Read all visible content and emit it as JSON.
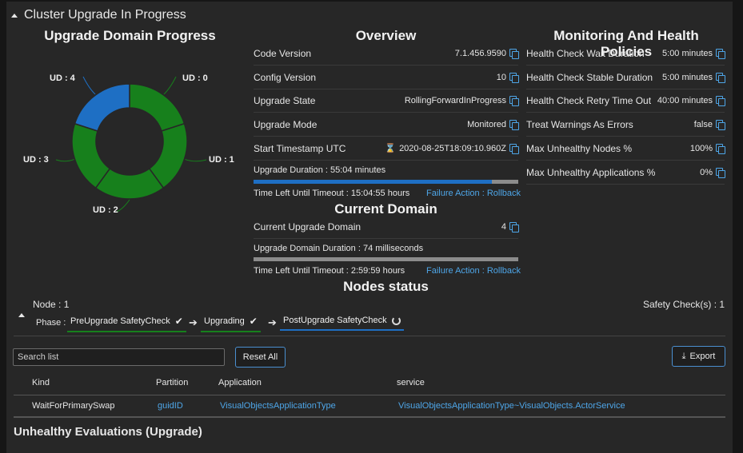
{
  "section": {
    "title": "Cluster Upgrade In Progress"
  },
  "upgrade_domain_progress": {
    "title": "Upgrade Domain Progress",
    "domains": [
      {
        "label": "UD : 0",
        "status": "completed",
        "color": "#17801c"
      },
      {
        "label": "UD : 1",
        "status": "completed",
        "color": "#17801c"
      },
      {
        "label": "UD : 2",
        "status": "completed",
        "color": "#17801c"
      },
      {
        "label": "UD : 3",
        "status": "completed",
        "color": "#17801c"
      },
      {
        "label": "UD : 4",
        "status": "in-progress",
        "color": "#1e6fc4"
      }
    ]
  },
  "overview": {
    "title": "Overview",
    "rows": [
      {
        "key": "Code Version",
        "value": "7.1.456.9590"
      },
      {
        "key": "Config Version",
        "value": "10"
      },
      {
        "key": "Upgrade State",
        "value": "RollingForwardInProgress"
      },
      {
        "key": "Upgrade Mode",
        "value": "Monitored"
      },
      {
        "key": "Start Timestamp UTC",
        "value": "2020-08-25T18:09:10.960Z"
      }
    ],
    "upgrade_duration": "Upgrade Duration : 55:04 minutes",
    "upgrade_progress": 0.9,
    "time_left": "Time Left Until Timeout : 15:04:55 hours",
    "failure_action": "Failure Action : Rollback"
  },
  "current_domain": {
    "title": "Current Domain",
    "key": "Current Upgrade Domain",
    "value": "4",
    "duration": "Upgrade Domain Duration : 74 milliseconds",
    "progress": 0.0,
    "time_left": "Time Left Until Timeout : 2:59:59 hours",
    "failure_action": "Failure Action : Rollback"
  },
  "monitoring": {
    "title": "Monitoring And Health Policies",
    "rows": [
      {
        "key": "Health Check Wait Duration",
        "value": "5:00 minutes"
      },
      {
        "key": "Health Check Stable Duration",
        "value": "5:00 minutes"
      },
      {
        "key": "Health Check Retry Time Out",
        "value": "40:00 minutes"
      },
      {
        "key": "Treat Warnings As Errors",
        "value": "false"
      },
      {
        "key": "Max Unhealthy Nodes %",
        "value": "100%"
      },
      {
        "key": "Max Unhealthy Applications %",
        "value": "0%"
      }
    ]
  },
  "nodes_status": {
    "title": "Nodes status",
    "node": "Node : 1",
    "phase_label": "Phase :",
    "safety_checks": "Safety Check(s) : 1",
    "phases": [
      {
        "label": "PreUpgrade SafetyCheck",
        "state": "done",
        "color": "#17801c"
      },
      {
        "label": "Upgrading",
        "state": "done",
        "color": "#17801c"
      },
      {
        "label": "PostUpgrade SafetyCheck",
        "state": "in-progress",
        "color": "#1e6fc4"
      }
    ]
  },
  "table": {
    "search_placeholder": "Search list",
    "reset_label": "Reset All",
    "export_label": "Export",
    "headers": [
      "Kind",
      "Partition",
      "Application",
      "service"
    ],
    "rows": [
      [
        "WaitForPrimarySwap",
        "guidID",
        "VisualObjectsApplicationType",
        "VisualObjectsApplicationType~VisualObjects.ActorService"
      ]
    ]
  },
  "unhealthy": {
    "title": "Unhealthy Evaluations (Upgrade)"
  }
}
